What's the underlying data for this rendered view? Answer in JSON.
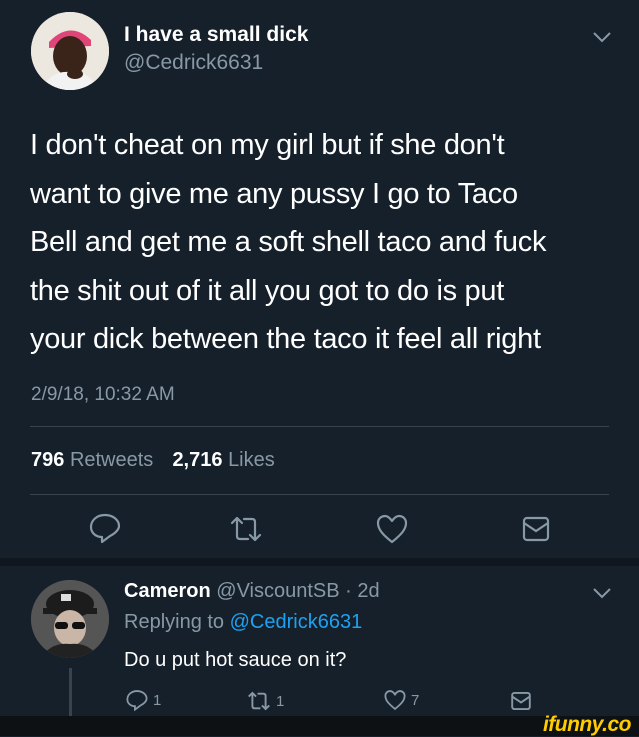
{
  "tweet": {
    "display_name": "I have a small dick",
    "handle": "@Cedrick6631",
    "text_lines": [
      "I don't cheat on my girl but if she don't",
      "want to give me any pussy I go to Taco",
      "Bell and get me a soft shell taco and fuck",
      "the shit out of it all you got to do is put",
      "your dick between the taco it feel all right"
    ],
    "timestamp": "2/9/18, 10:32 AM",
    "retweets_count": "796",
    "retweets_label": "Retweets",
    "likes_count": "2,716",
    "likes_label": "Likes",
    "icons": [
      "reply-icon",
      "retweet-icon",
      "like-icon",
      "message-icon",
      "chevron-down-icon"
    ]
  },
  "reply": {
    "display_name": "Cameron",
    "handle": "@ViscountSB",
    "age": "· 2d",
    "replying_to_label": "Replying to",
    "replying_to_handle": "@Cedrick6631",
    "text": "Do u put hot sauce on it?",
    "reply_count": "1",
    "retweet_count": "1",
    "like_count": "7"
  },
  "watermark": "ifunny.co",
  "colors": {
    "background": "#15202b",
    "text": "#ffffff",
    "muted": "#8899a6",
    "accent": "#1da1f2",
    "divider": "#38444d",
    "watermark": "#ffcc00"
  }
}
